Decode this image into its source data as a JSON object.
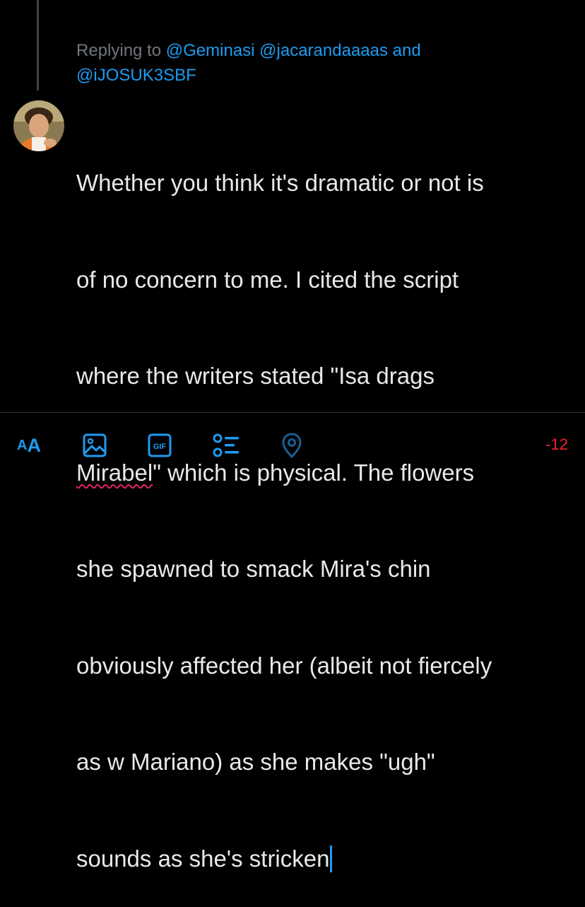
{
  "reply_context": {
    "prefix": "Replying to",
    "mentions": [
      "@Geminasi",
      "@jacarandaaaas"
    ],
    "conjunction": "and",
    "last_mention": "@iJOSUK3SBF"
  },
  "compose": {
    "lines": [
      "Whether you think it's dramatic or not is",
      "of no concern to me. I cited the script",
      "where the writers stated \"Isa drags",
      "\" which is physical. The flowers",
      "she spawned to smack Mira's chin",
      "obviously affected her (albeit not fiercely",
      "as w Mariano) as she makes \"ugh\"",
      "sounds as she's stricken"
    ],
    "misspelled_word": "Mirabel"
  },
  "toolbar": {
    "text_format_small": "A",
    "text_format_big": "A",
    "image_icon": "image-icon",
    "gif_icon": "gif-icon",
    "gif_label": "GIF",
    "poll_icon": "poll-list-icon",
    "location_icon": "location-pin-icon",
    "char_counter": "-12"
  },
  "colors": {
    "background": "#000000",
    "accent": "#1d9bf0",
    "text": "#e7e9ea",
    "muted": "#71767b",
    "error": "#f4212e",
    "divider": "#2f3336"
  }
}
